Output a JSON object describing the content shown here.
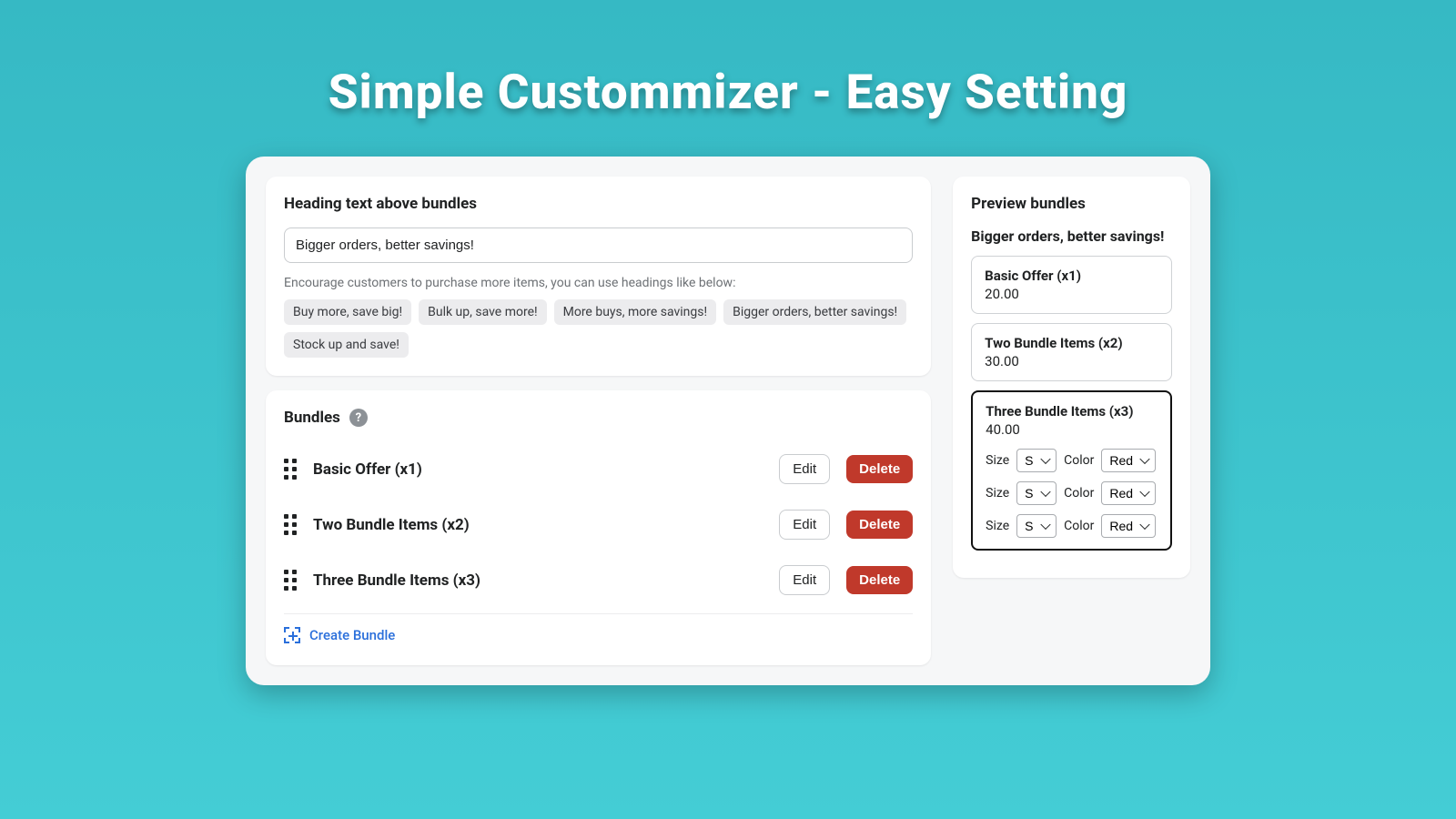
{
  "banner": "Simple Custommizer -  Easy Setting",
  "heading_section": {
    "title": "Heading text above bundles",
    "value": "Bigger orders, better savings!",
    "helper": "Encourage customers to purchase more items, you can use headings like below:",
    "suggestions": [
      "Buy more, save big!",
      "Bulk up, save more!",
      "More buys, more savings!",
      "Bigger orders, better savings!",
      "Stock up and save!"
    ]
  },
  "bundles_section": {
    "title": "Bundles",
    "edit_label": "Edit",
    "delete_label": "Delete",
    "create_label": "Create Bundle",
    "items": [
      {
        "name": "Basic Offer (x1)"
      },
      {
        "name": "Two Bundle Items (x2)"
      },
      {
        "name": "Three Bundle Items (x3)"
      }
    ]
  },
  "preview": {
    "title": "Preview bundles",
    "heading": "Bigger orders, better savings!",
    "option_labels": {
      "size": "Size",
      "color": "Color"
    },
    "option_values": {
      "size": "S",
      "color": "Red"
    },
    "cards": [
      {
        "title": "Basic Offer (x1)",
        "price": "20.00",
        "selected": false,
        "options_count": 0
      },
      {
        "title": "Two Bundle Items (x2)",
        "price": "30.00",
        "selected": false,
        "options_count": 0
      },
      {
        "title": "Three Bundle Items (x3)",
        "price": "40.00",
        "selected": true,
        "options_count": 3
      }
    ]
  }
}
